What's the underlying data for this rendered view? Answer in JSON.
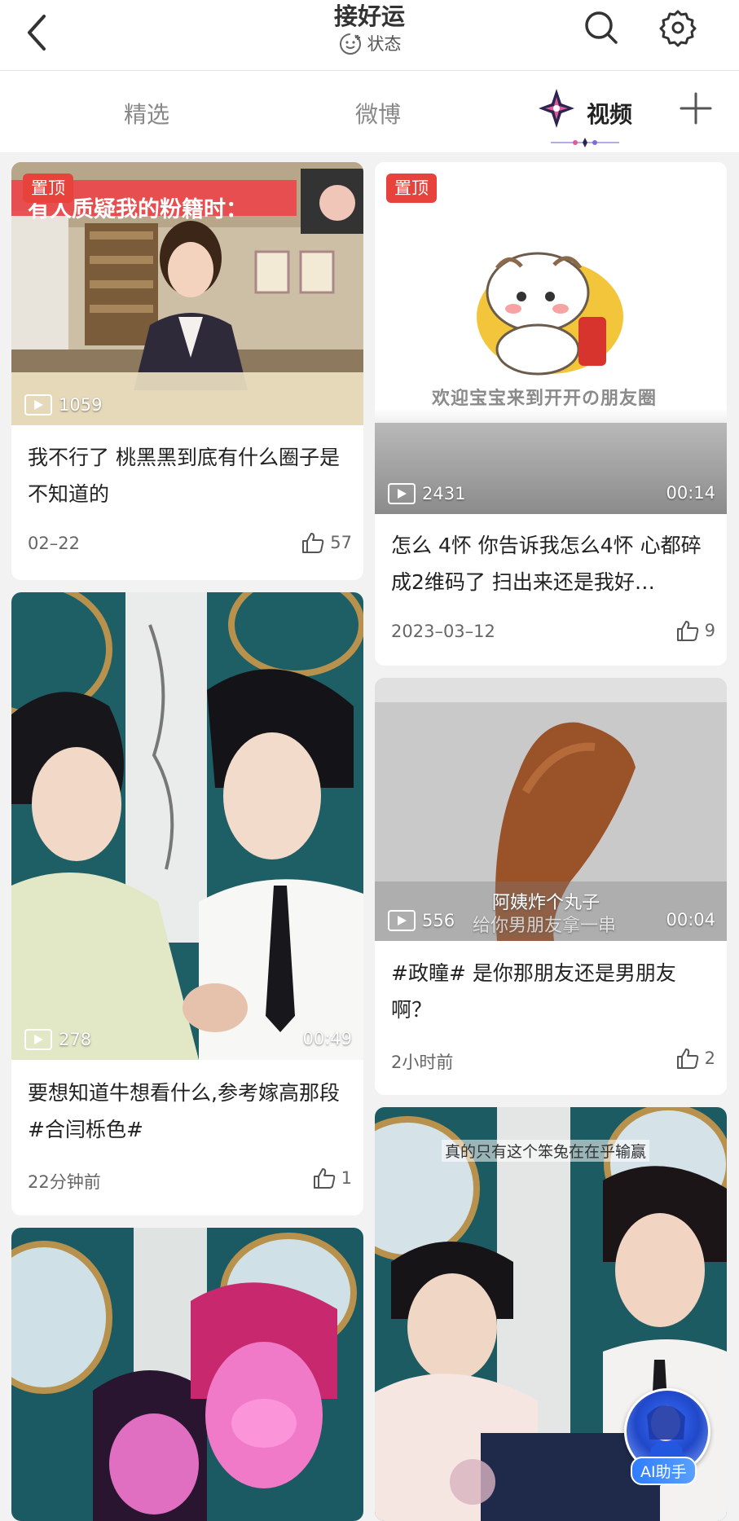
{
  "header": {
    "title": "接好运",
    "status_label": "状态"
  },
  "tabs": [
    {
      "label": "精选",
      "active": false
    },
    {
      "label": "微博",
      "active": false
    },
    {
      "label": "视频",
      "active": true
    }
  ],
  "cards": [
    {
      "pinned_label": "置顶",
      "overlay_caption": "有人质疑我的粉籍时：",
      "play_count": "1059",
      "title": "我不行了 桃黑黑到底有什么圈子是不知道的",
      "date": "02–22",
      "likes": "57"
    },
    {
      "pinned_label": "置顶",
      "overlay_caption": "欢迎宝宝来到开开の朋友圈",
      "play_count": "2431",
      "duration": "00:14",
      "title": "怎么 4怀 你告诉我怎么4怀 心都碎成2维码了 扫出来还是我好…",
      "date": "2023–03–12",
      "likes": "9"
    },
    {
      "play_count": "278",
      "duration": "00:49",
      "title": "要想知道牛想看什么,参考嫁高那段#合闫栎色#",
      "date": "22分钟前",
      "likes": "1"
    },
    {
      "overlay_caption_1": "阿姨炸个丸子",
      "overlay_caption_2": "给你男朋友拿一串",
      "play_count": "556",
      "duration": "00:04",
      "title": "#政瞳# 是你那朋友还是男朋友啊？",
      "date": "2小时前",
      "likes": "2"
    },
    {
      "overlay_caption": ""
    },
    {
      "overlay_caption": "真的只有这个笨兔在在乎输赢"
    }
  ],
  "ai_assistant": {
    "label": "AI助手"
  },
  "colors": {
    "pin_badge": "#e8423c",
    "background": "#f2f2f2",
    "card": "#ffffff"
  }
}
